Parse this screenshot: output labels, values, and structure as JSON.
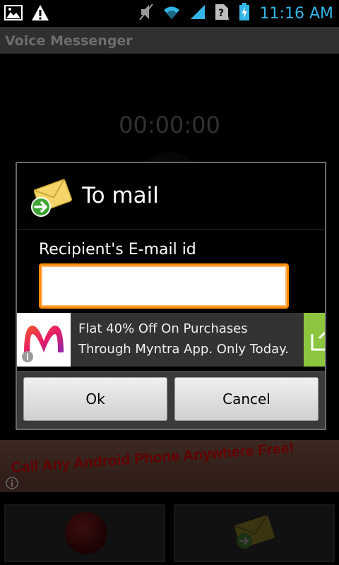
{
  "status_bar": {
    "time": "11:16 AM",
    "icons": [
      "image-notification-icon",
      "warning-icon",
      "mute-icon",
      "wifi-icon",
      "signal-icon",
      "no-sim-icon",
      "battery-charging-icon"
    ]
  },
  "app": {
    "title": "Voice Messenger",
    "timer": "00:00:00"
  },
  "dialog": {
    "title": "To mail",
    "field_label": "Recipient's E-mail id",
    "field_value": "",
    "ad": {
      "line1": "Flat 40% Off On Purchases",
      "line2": "Through Myntra App. Only Today."
    },
    "ok_label": "Ok",
    "cancel_label": "Cancel"
  },
  "banner_ad": {
    "text": "Call Any Android Phone Anywhere Free!"
  },
  "colors": {
    "accent": "#33b5e5",
    "input_focus": "#ff8a00",
    "record": "#b40000",
    "ad_green": "#8cc63f"
  }
}
